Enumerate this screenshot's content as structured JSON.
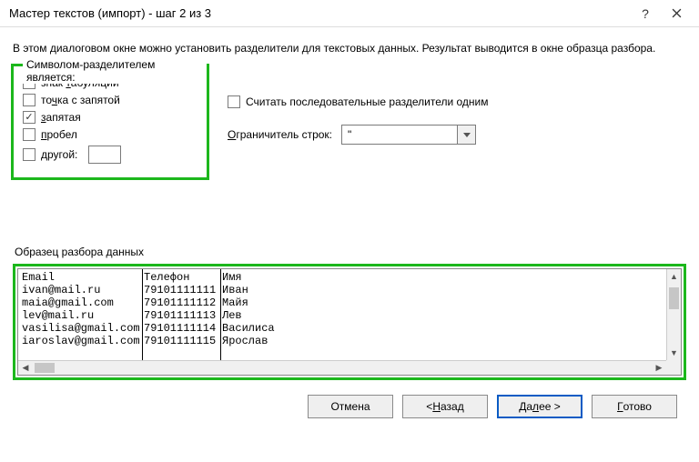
{
  "window": {
    "title": "Мастер текстов (импорт) - шаг 2 из 3"
  },
  "description": "В этом диалоговом окне можно установить разделители для текстовых данных. Результат выводится в окне образца разбора.",
  "delimiters": {
    "legend": "Символом-разделителем является:",
    "tab_pre": "знак ",
    "tab_u": "т",
    "tab_post": "абуляции",
    "semicolon_pre": "то",
    "semicolon_u": "ч",
    "semicolon_post": "ка с запятой",
    "comma_u": "з",
    "comma_post": "апятая",
    "space_u": "п",
    "space_post": "робел",
    "other_u": "д",
    "other_post": "ругой:",
    "tab_checked": false,
    "semicolon_checked": false,
    "comma_checked": true,
    "space_checked": false,
    "other_checked": false,
    "other_value": ""
  },
  "options": {
    "consecutive": "Считать последовательные разделители одним",
    "consecutive_checked": false,
    "qualifier_label_u": "О",
    "qualifier_label_post": "граничитель строк:",
    "qualifier_value": "\""
  },
  "preview": {
    "label": "Образец разбора данных",
    "columns": [
      "Email",
      "Телефон",
      "Имя"
    ],
    "rows": [
      [
        "ivan@mail.ru",
        "79101111111",
        "Иван"
      ],
      [
        "maia@gmail.com",
        "79101111112",
        "Майя"
      ],
      [
        "lev@mail.ru",
        "79101111113",
        "Лев"
      ],
      [
        "vasilisa@gmail.com",
        "79101111114",
        "Василиса"
      ],
      [
        "iaroslav@gmail.com",
        "79101111115",
        "Ярослав"
      ]
    ]
  },
  "buttons": {
    "cancel": "Отмена",
    "back_pre": "< ",
    "back_u": "Н",
    "back_post": "азад",
    "next_pre": "Да",
    "next_u": "л",
    "next_post": "ее >",
    "finish_u": "Г",
    "finish_post": "отово"
  }
}
